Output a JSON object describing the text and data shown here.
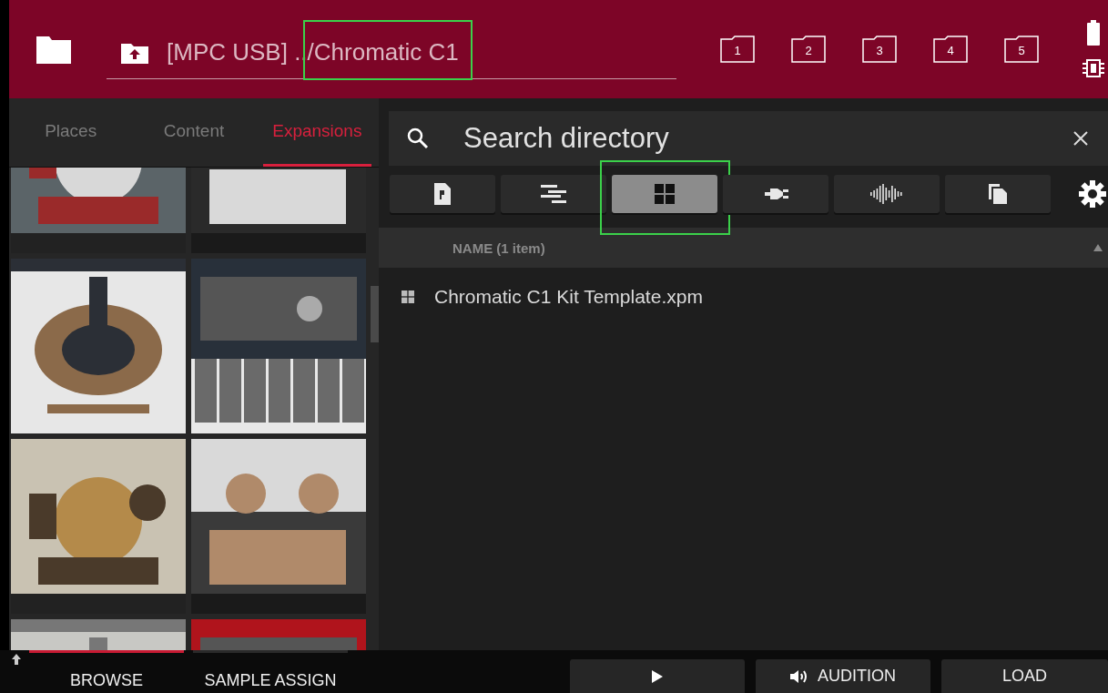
{
  "top_bar": {
    "path": {
      "text": "[MPC USB] ../Chromatic C1",
      "highlighted": true
    },
    "quick_folders": [
      "1",
      "2",
      "3",
      "4",
      "5"
    ]
  },
  "left_panel": {
    "tabs": [
      {
        "label": "Places",
        "selected": false
      },
      {
        "label": "Content",
        "selected": false
      },
      {
        "label": "Expansions",
        "selected": true
      }
    ]
  },
  "search": {
    "placeholder": "Search directory"
  },
  "filters": [
    {
      "kind": "program",
      "selected": false,
      "highlighted": false
    },
    {
      "kind": "sequence",
      "selected": false,
      "highlighted": false
    },
    {
      "kind": "kit",
      "selected": true,
      "highlighted": true
    },
    {
      "kind": "plugin",
      "selected": false,
      "highlighted": false
    },
    {
      "kind": "sample",
      "selected": false,
      "highlighted": false
    },
    {
      "kind": "multi",
      "selected": false,
      "highlighted": false
    }
  ],
  "list": {
    "header": "NAME (1 item)",
    "rows": [
      {
        "kind": "kit",
        "name": "Chromatic C1 Kit Template.xpm"
      }
    ]
  },
  "bottom_bar": {
    "tabs": [
      {
        "label": "BROWSE",
        "selected": true
      },
      {
        "label": "SAMPLE ASSIGN",
        "selected": false
      }
    ],
    "buttons": [
      {
        "kind": "play"
      },
      {
        "kind": "audition",
        "label": "AUDITION"
      },
      {
        "kind": "load",
        "label": "LOAD"
      }
    ]
  }
}
